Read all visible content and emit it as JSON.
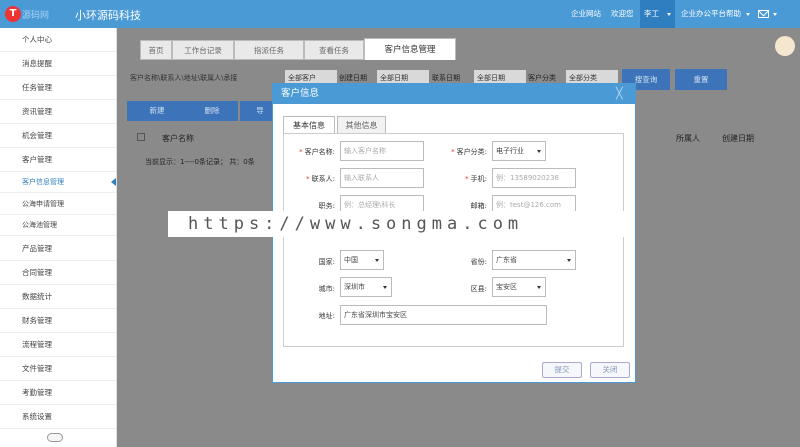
{
  "header": {
    "logo_letter": "T",
    "logo_text": "源码网",
    "app_title": "小环源码科技",
    "nav": [
      "企业网站",
      "欢迎您",
      "李工",
      "企业办公平台帮助"
    ],
    "brand_color": "#4a9ad6"
  },
  "sidebar": {
    "items": [
      "个人中心",
      "消息提醒",
      "任务管理",
      "资讯管理",
      "机会管理",
      "客户管理"
    ],
    "subitems": [
      "客户信息管理",
      "公海申请管理",
      "公海池管理"
    ],
    "items2": [
      "产品管理",
      "合同管理",
      "数据统计",
      "财务管理",
      "流程管理",
      "文件管理",
      "考勤管理",
      "系统设置"
    ]
  },
  "tabs": [
    "首页",
    "工作台记录",
    "指派任务",
    "查看任务",
    "客户信息管理"
  ],
  "toolbar": {
    "search_placeholder": "客户名称\\联系人\\地址\\联属人\\承接",
    "selects": [
      "全部客户",
      "全部日期",
      "全部分类"
    ],
    "labels": [
      "创建日期",
      "联系日期",
      "客户分类"
    ],
    "search_button": "搜查询",
    "reset_button": "重置",
    "new_button": "新建",
    "delete_button": "删除",
    "more_button": "导"
  },
  "table": {
    "headers": [
      "客户名称",
      "所属人",
      "创建日期"
    ],
    "status": "当前显示：1----0条记录；   共：0条"
  },
  "watermark": "https://www.songma.com",
  "modal": {
    "title": "客户信息",
    "close": "╳",
    "tabs": [
      "基本信息",
      "其他信息"
    ],
    "fields": {
      "name_label": "客户名称:",
      "name_placeholder": "输入客户名称",
      "category_label": "客户分类:",
      "category_value": "电子行业",
      "contact_label": "联系人:",
      "contact_placeholder": "输入联系人",
      "phone_label": "手机:",
      "phone_placeholder": "例：13589020236",
      "title_label": "职务:",
      "title_placeholder": "例：总经理\\科长",
      "email_label": "邮箱:",
      "email_placeholder": "例：test@126.com",
      "country_label": "国家:",
      "country_value": "中国",
      "province_label": "省份:",
      "province_value": "广东省",
      "city_label": "城市:",
      "city_value": "深圳市",
      "district_label": "区县:",
      "district_value": "宝安区",
      "address_label": "地址:",
      "address_value": "广东省深圳市宝安区"
    },
    "submit": "提交",
    "close_button": "关闭"
  }
}
